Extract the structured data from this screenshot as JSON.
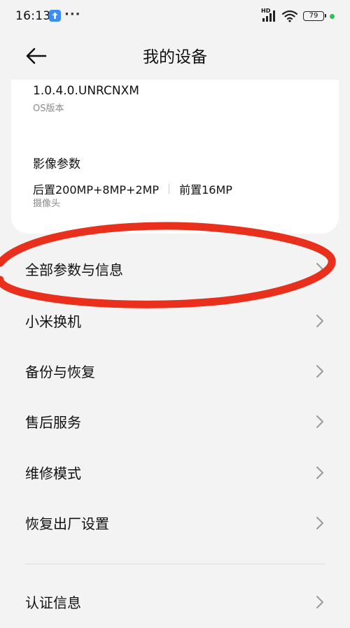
{
  "status_bar": {
    "time": "16:13",
    "notification_icon": "upload-arrow-icon",
    "more": "···",
    "network": "HD",
    "battery": "79",
    "charging_color": "#2fbf55"
  },
  "header": {
    "title": "我的设备",
    "back_icon": "back-arrow-icon"
  },
  "info": {
    "os_version": "1.0.4.0.UNRCNXM",
    "os_version_label": "OS版本",
    "camera_title": "影像参数",
    "rear_camera": "后置200MP+8MP+2MP",
    "front_camera": "前置16MP",
    "camera_label": "摄像头"
  },
  "menu": [
    {
      "label": "全部参数与信息"
    },
    {
      "label": "小米换机"
    },
    {
      "label": "备份与恢复"
    },
    {
      "label": "售后服务"
    },
    {
      "label": "维修模式"
    },
    {
      "label": "恢复出厂设置"
    },
    {
      "label": "认证信息"
    }
  ],
  "annotation": {
    "shape": "hand-drawn-ellipse",
    "color": "#e8301c"
  }
}
